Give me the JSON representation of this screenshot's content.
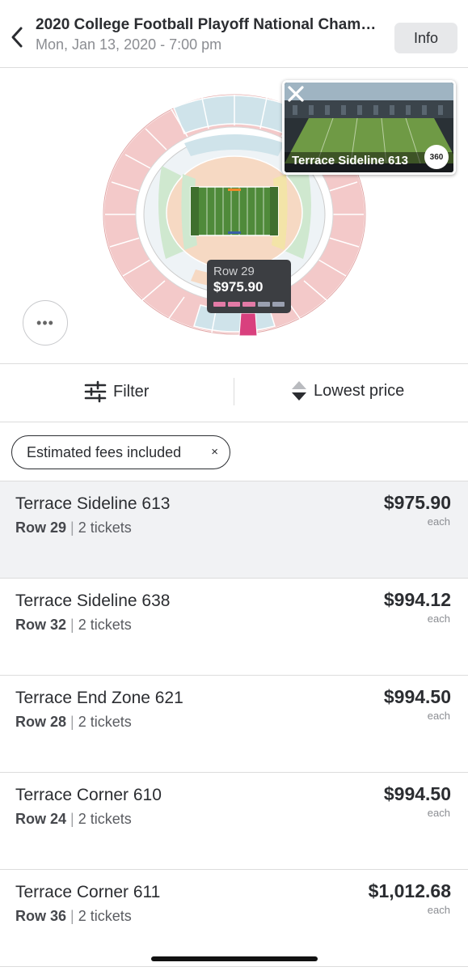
{
  "header": {
    "title": "2020 College Football Playoff National Champi...",
    "subtitle": "Mon, Jan 13, 2020 - 7:00 pm",
    "info_label": "Info"
  },
  "map": {
    "preview_label": "Terrace Sideline 613",
    "badge_360": "360",
    "more_label": "•••",
    "tooltip": {
      "row": "Row 29",
      "price": "$975.90"
    }
  },
  "toolbar": {
    "filter_label": "Filter",
    "sort_label": "Lowest price"
  },
  "chip": {
    "label": "Estimated fees included",
    "close": "×"
  },
  "listings": [
    {
      "section": "Terrace Sideline 613",
      "row": "Row 29",
      "tickets": "2 tickets",
      "price": "$975.90",
      "each": "each"
    },
    {
      "section": "Terrace Sideline 638",
      "row": "Row 32",
      "tickets": "2 tickets",
      "price": "$994.12",
      "each": "each"
    },
    {
      "section": "Terrace End Zone 621",
      "row": "Row 28",
      "tickets": "2 tickets",
      "price": "$994.50",
      "each": "each"
    },
    {
      "section": "Terrace Corner 610",
      "row": "Row 24",
      "tickets": "2 tickets",
      "price": "$994.50",
      "each": "each"
    },
    {
      "section": "Terrace Corner 611",
      "row": "Row 36",
      "tickets": "2 tickets",
      "price": "$1,012.68",
      "each": "each"
    }
  ],
  "colors": {
    "text": "#2b2d31",
    "muted": "#8b8d92",
    "selected_bg": "#f1f2f4",
    "highlight_section": "#d9407e"
  },
  "icons": {
    "back": "chevron-left-icon",
    "filter": "sliders-icon",
    "sort": "sort-arrows-icon",
    "close": "close-icon"
  }
}
